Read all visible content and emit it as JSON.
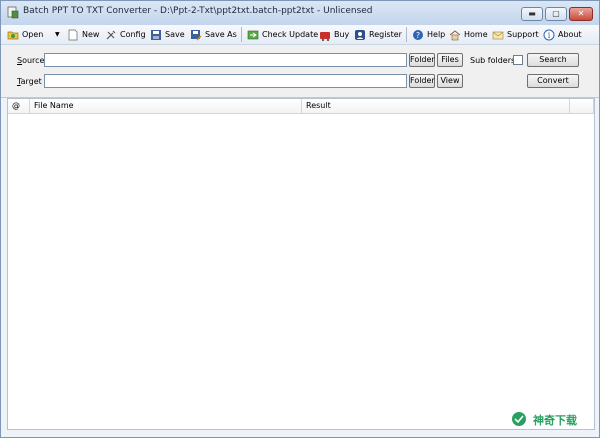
{
  "window": {
    "title": "Batch PPT TO TXT Converter - D:\\Ppt-2-Txt\\ppt2txt.batch-ppt2txt - Unlicensed"
  },
  "title_controls": {
    "minimize": "▬",
    "maximize": "▢",
    "close": "✕"
  },
  "toolbar": {
    "open": "Open",
    "open_dropdown": "▼",
    "new": "New",
    "config": "Config",
    "save": "Save",
    "save_as": "Save As",
    "check_update": "Check Update",
    "buy": "Buy",
    "register": "Register",
    "help": "Help",
    "home": "Home",
    "support": "Support",
    "about": "About"
  },
  "form": {
    "source_label_key": "S",
    "source_label_rest": "ource",
    "source_value": "",
    "target_label_key": "T",
    "target_label_rest": "arget",
    "target_value": "",
    "source_folder": "Folder",
    "source_files": "Files",
    "target_folder": "Folder",
    "target_view": "View",
    "sub_folders_label": "Sub folders",
    "sub_folders_checked": false,
    "search": "Search",
    "convert": "Convert"
  },
  "list": {
    "columns": [
      "@",
      "File Name",
      "Result",
      ""
    ],
    "rows": []
  },
  "watermark": {
    "text": "神奇下载"
  }
}
